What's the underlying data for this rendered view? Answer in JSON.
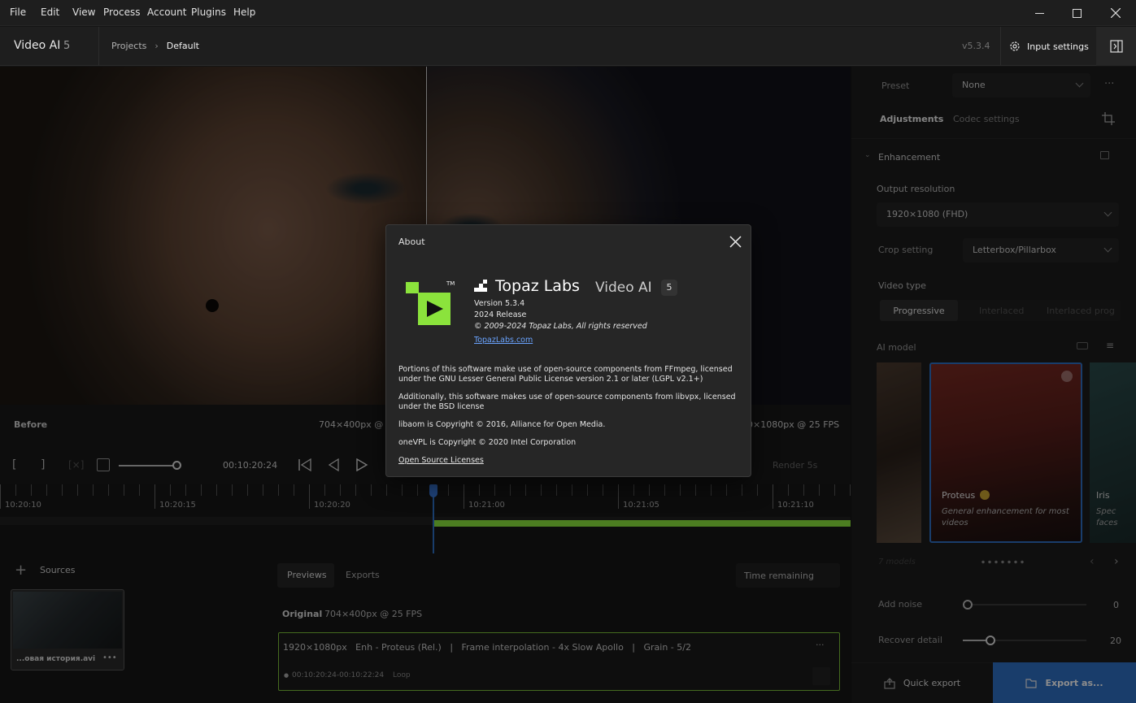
{
  "menubar": {
    "items": [
      "File",
      "Edit",
      "View",
      "Process",
      "Account",
      "Plugins",
      "Help"
    ]
  },
  "header": {
    "app_name": "Video AI",
    "app_major": "5",
    "breadcrumb_projects": "Projects",
    "breadcrumb_current": "Default",
    "version": "v5.3.4",
    "input_settings_label": "Input settings"
  },
  "preview": {
    "before_label": "Before",
    "before_info": "704×400px @ 2",
    "after_info": "0×1080px @ 25 FPS"
  },
  "controls": {
    "timecode": "00:10:20:24",
    "render_label": "Render 5s"
  },
  "timeline": {
    "ticks": [
      "10:20:10",
      "10:20:15",
      "10:20:20",
      "10:21:00",
      "10:21:05",
      "10:21:10"
    ]
  },
  "sources": {
    "label": "Sources",
    "thumb_name": "...овая история.avi",
    "thumb_menu": "•••"
  },
  "bottom_tabs": {
    "previews": "Previews",
    "exports": "Exports",
    "sort": "Time remaining"
  },
  "original": {
    "label": "Original",
    "info": "704×400px @ 25 FPS"
  },
  "preview_item": {
    "desc": "1920×1080px   Enh - Proteus (Rel.)   |   Frame interpolation - 4x Slow Apollo   |   Grain - 5/2",
    "range": "00:10:20:24-00:10:22:24",
    "loop": "Loop",
    "menu": "···"
  },
  "right_panel": {
    "preset_label": "Preset",
    "preset_value": "None",
    "tab_adjustments": "Adjustments",
    "tab_codec": "Codec settings",
    "enhancement_label": "Enhancement",
    "output_res_label": "Output resolution",
    "output_res_value": "1920×1080 (FHD)",
    "crop_label": "Crop setting",
    "crop_value": "Letterbox/Pillarbox",
    "video_type_label": "Video type",
    "video_types": [
      "Progressive",
      "Interlaced",
      "Interlaced prog"
    ],
    "ai_model_label": "AI model",
    "model_main_name": "Proteus",
    "model_main_desc": "General enhancement for most videos",
    "model_next_name": "Iris",
    "model_next_desc": "Spec faces",
    "models_count": "7 models",
    "add_noise_label": "Add noise",
    "add_noise_value": "0",
    "add_noise_level": 0,
    "recover_label": "Recover detail",
    "recover_value": "20",
    "recover_level": 0.2,
    "quick_export": "Quick export",
    "export_as": "Export as..."
  },
  "about": {
    "title": "About",
    "brand": "Topaz Labs",
    "product": "Video AI",
    "badge": "5",
    "tm": "TM",
    "version": "Version 5.3.4",
    "release": "2024 Release",
    "copyright": "© 2009-2024 Topaz Labs, All rights reserved",
    "website": "TopazLabs.com",
    "p1": "Portions of this software make use of open-source components from FFmpeg, licensed under the GNU Lesser General Public License version 2.1 or later (LGPL v2.1+)",
    "p2": "Additionally, this software makes use of open-source components from libvpx, licensed under the BSD license",
    "p3": "libaom is Copyright © 2016, Alliance for Open Media.",
    "p4": "oneVPL is Copyright © 2020 Intel Corporation",
    "licenses_link": "Open Source Licenses"
  },
  "colors": {
    "accent_green": "#8be33c",
    "export_blue": "#2f6fc4",
    "link_blue": "#6aa4ff"
  }
}
